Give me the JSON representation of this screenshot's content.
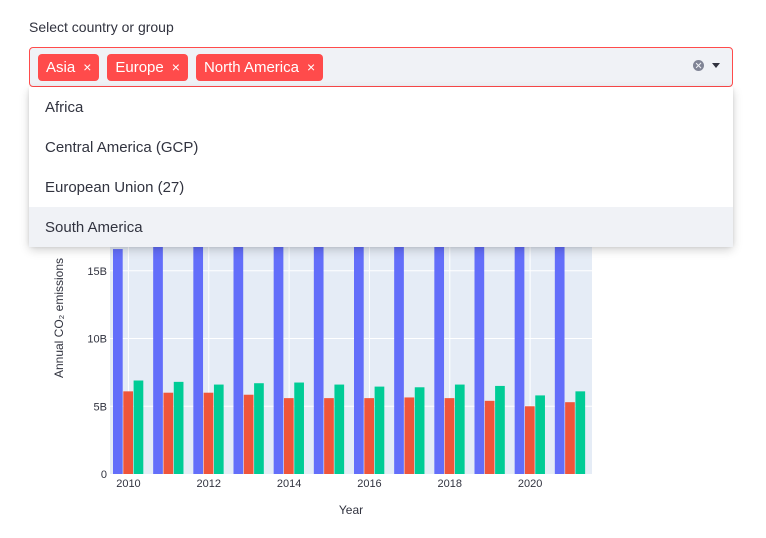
{
  "selector": {
    "label": "Select country or group",
    "selected": [
      "Asia",
      "Europe",
      "North America"
    ],
    "remove_glyph": "×",
    "options": [
      "Africa",
      "Central America (GCP)",
      "European Union (27)",
      "South America"
    ],
    "highlighted_option": "South America"
  },
  "colors": {
    "accent": "#ff4b4b",
    "input_bg": "#f0f2f6",
    "series": [
      "#636efa",
      "#ef553b",
      "#00cc96"
    ],
    "plot_bg": "#e5ecf6"
  },
  "chart_data": {
    "type": "bar",
    "x": [
      2010,
      2011,
      2012,
      2013,
      2014,
      2015,
      2016,
      2017,
      2018,
      2019,
      2020,
      2021
    ],
    "series": [
      {
        "name": "",
        "values": [
          16.6,
          17.5,
          17.8,
          17.9,
          18.0,
          18.0,
          18.0,
          18.3,
          18.7,
          19.0,
          18.5,
          19.5
        ]
      },
      {
        "name": "",
        "values": [
          6.1,
          6.0,
          6.0,
          5.85,
          5.6,
          5.6,
          5.6,
          5.65,
          5.6,
          5.4,
          5.0,
          5.3
        ]
      },
      {
        "name": "",
        "values": [
          6.9,
          6.8,
          6.6,
          6.7,
          6.75,
          6.6,
          6.45,
          6.4,
          6.6,
          6.5,
          5.8,
          6.1
        ]
      }
    ],
    "xlabel": "Year",
    "ylabel": "Annual CO₂ emissions",
    "yticks": [
      0,
      5,
      10,
      15
    ],
    "ytick_labels": [
      "0",
      "5B",
      "10B",
      "15B"
    ],
    "xticks": [
      2010,
      2012,
      2014,
      2016,
      2018,
      2020
    ],
    "grid": true
  }
}
